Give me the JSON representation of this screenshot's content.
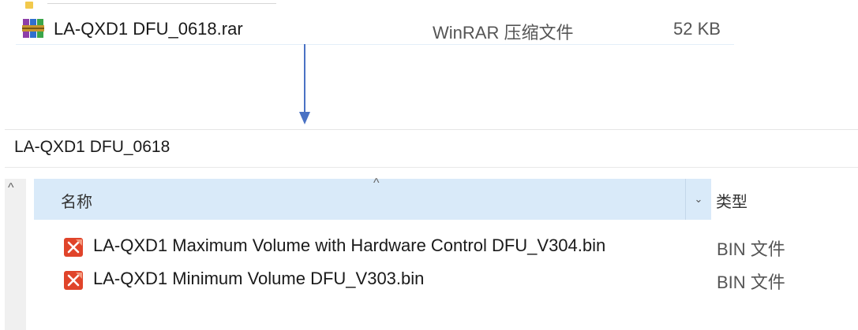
{
  "archive": {
    "name": "LA-QXD1 DFU_0618.rar",
    "type": "WinRAR 压缩文件",
    "size": "52 KB",
    "icon": "winrar-archive-icon"
  },
  "arrow": {
    "color": "#4a72c4"
  },
  "explorer": {
    "folder_title": "LA-QXD1 DFU_0618",
    "columns": {
      "name": "名称",
      "type": "类型",
      "sort_indicator": "^",
      "dropdown": "⌄"
    },
    "scroll_up": "^",
    "files": [
      {
        "name": "LA-QXD1 Maximum Volume with Hardware Control DFU_V304.bin",
        "type": "BIN 文件",
        "icon": "bin-file-icon"
      },
      {
        "name": "LA-QXD1 Minimum Volume DFU_V303.bin",
        "type": "BIN 文件",
        "icon": "bin-file-icon"
      }
    ]
  },
  "colors": {
    "header_bg": "#d9eaf9",
    "bin_icon": "#e0442a",
    "scrollbar_bg": "#f0f0f0"
  }
}
